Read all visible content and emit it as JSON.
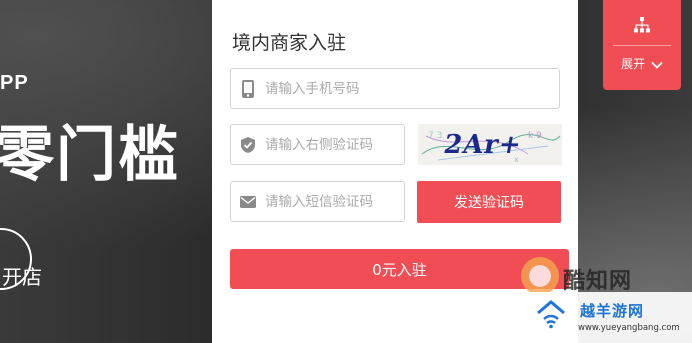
{
  "background": {
    "promo_pp": "PP",
    "promo_title": "零门槛",
    "open_store_label": "开店"
  },
  "form": {
    "title": "境内商家入驻",
    "phone_placeholder": "请输入手机号码",
    "captcha_placeholder": "请输入右侧验证码",
    "captcha_image_text": "2Ar+",
    "sms_placeholder": "请输入短信验证码",
    "send_code_label": "发送验证码",
    "submit_label": "0元入驻",
    "icons": {
      "phone": "mobile-phone-icon",
      "captcha": "shield-icon",
      "sms": "envelope-icon"
    }
  },
  "side_panel": {
    "top_icon": "org-chart-icon",
    "expand_label": "展开",
    "expand_icon": "chevron-down-icon"
  },
  "watermarks": {
    "site_name": "酷知网",
    "yueyang_name": "越羊游网",
    "yueyang_url": "www.yueyangbang.com"
  },
  "colors": {
    "accent": "#f04d54",
    "card_bg": "#ffffff",
    "placeholder": "#aaaaaa"
  }
}
